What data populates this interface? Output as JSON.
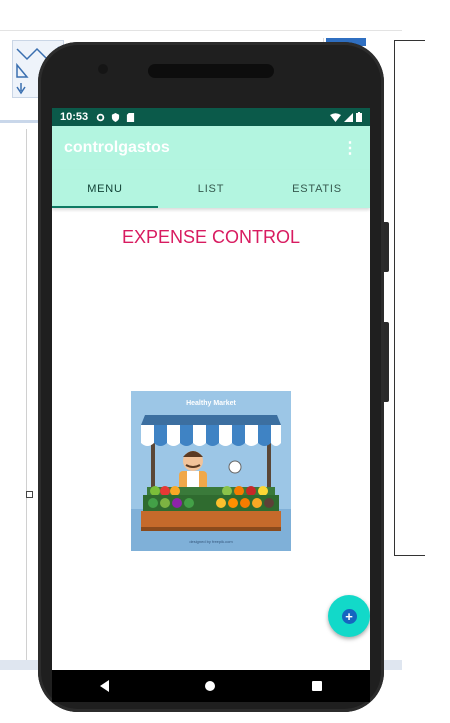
{
  "status_bar": {
    "time": "10:53",
    "icons": [
      "settings-icon",
      "shield-icon",
      "sd-card-icon",
      "wifi-icon",
      "signal-icon",
      "battery-icon"
    ]
  },
  "app_bar": {
    "title": "controlgastos",
    "overflow_icon": "more-vert-icon",
    "color": "#b3f5e0"
  },
  "tabs": [
    {
      "label": "MENU",
      "active": true
    },
    {
      "label": "LIST",
      "active": false
    },
    {
      "label": "ESTATIS",
      "active": false
    }
  ],
  "main": {
    "heading": "EXPENSE CONTROL",
    "heading_color": "#d81b60",
    "image": {
      "banner_text": "Healthy Market",
      "footer_text": "designed by freepik.com"
    }
  },
  "fab": {
    "icon": "add-icon",
    "symbol": "+",
    "color": "#12d9c9"
  },
  "nav_bar": {
    "icons": [
      "back-icon",
      "home-icon",
      "recents-icon"
    ]
  }
}
